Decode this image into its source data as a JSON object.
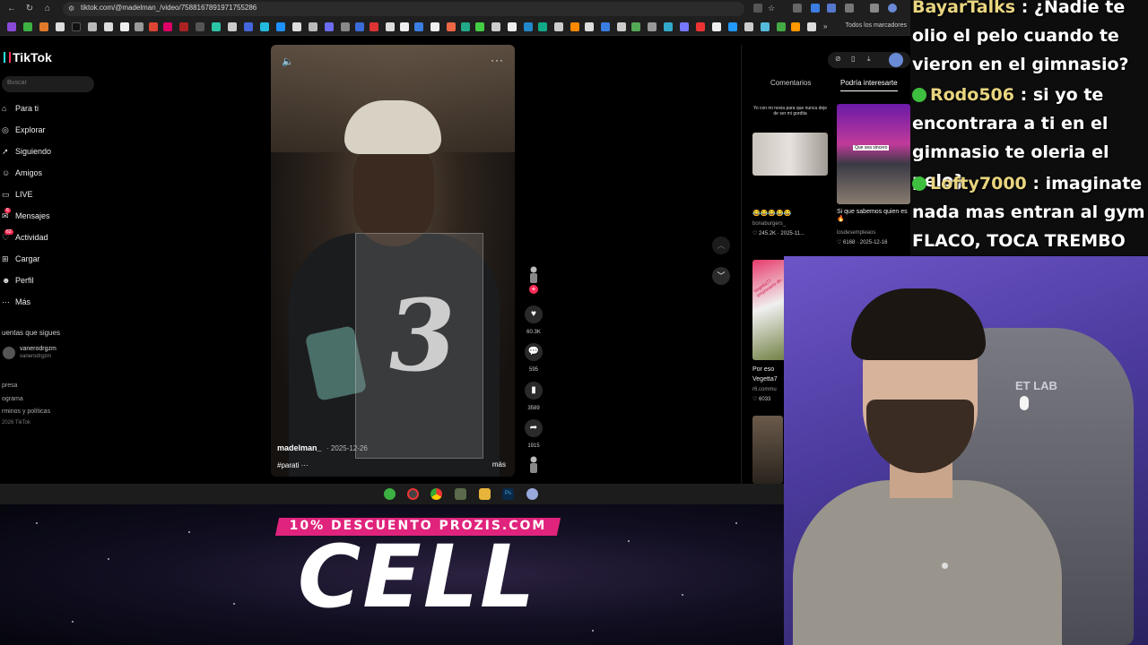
{
  "browser": {
    "url": "tiktok.com/@madelman_/video/7588167891971755286",
    "bookmarks_label": "Todos los marcadores"
  },
  "tiktok": {
    "logo": "TikTok",
    "search_placeholder": "Buscar",
    "nav": [
      {
        "label": "Para ti",
        "icon": "home-icon"
      },
      {
        "label": "Explorar",
        "icon": "compass-icon"
      },
      {
        "label": "Siguiendo",
        "icon": "following-icon"
      },
      {
        "label": "Amigos",
        "icon": "friends-icon"
      },
      {
        "label": "LIVE",
        "icon": "live-icon"
      },
      {
        "label": "Mensajes",
        "icon": "messages-icon",
        "badge": "6"
      },
      {
        "label": "Actividad",
        "icon": "activity-icon",
        "badge": "62"
      },
      {
        "label": "Cargar",
        "icon": "upload-icon"
      },
      {
        "label": "Perfil",
        "icon": "profile-icon"
      },
      {
        "label": "Más",
        "icon": "more-icon"
      }
    ],
    "following_title": "uentas que sigues",
    "following": {
      "name": "vanerodrgzm",
      "handle": "vanerodrgzm"
    },
    "footer": [
      "presa",
      "ograma",
      "rminos y políticas"
    ],
    "copyright": "2026 TikTok"
  },
  "video": {
    "author": "madelman_",
    "date": "· 2025-12-26",
    "caption": "#parati ···",
    "more": "más",
    "likes": "60.3K",
    "comments": "595",
    "saves": "3589",
    "shares": "1915"
  },
  "right_panel": {
    "tabs": [
      "Comentarios",
      "Podría interesarte"
    ],
    "active_tab": "Podría interesarte",
    "cards": [
      {
        "top_text": "Yo con mi novia para que nunca deje de ser mi gordita",
        "emoji": "😂😂😂😂😂",
        "author": "bonaburgers_",
        "stats": "♡ 245.2K · 2025-11..."
      },
      {
        "thumb_caption": "Que sea sincero",
        "title": "Si que sabemos quien es🔥",
        "author": "losdesempleaos",
        "stats": "♡ 6168 · 2025-12-16"
      },
      {
        "thumb_caption": "Vegetta77 empresario de...",
        "title": "Por eso Vegetta7",
        "author": "r6.commu",
        "stats": "♡ 6033"
      }
    ]
  },
  "chat": [
    {
      "user": "BayarTalks",
      "text": ": ¿Nadie te olio el pelo cuando te vieron en el gimnasio?",
      "badge": false
    },
    {
      "user": "Rodo506",
      "text": ": si yo te encontrara a ti en el gimnasio te oleria el pelo}",
      "badge": true
    },
    {
      "user": "Lofty7000",
      "text": ": imaginate nada mas entran al gym FLACO, TOCA TREMBO",
      "badge": true
    }
  ],
  "promo": {
    "banner": "10% DESCUENTO PROZIS.COM",
    "title": "CELL"
  },
  "chair_logo": "ET LAB",
  "colors": {
    "tiktok_red": "#fe2c55",
    "tiktok_cyan": "#25f4ee",
    "promo_pink": "#e0237c",
    "chat_username": "#e9d57f"
  }
}
